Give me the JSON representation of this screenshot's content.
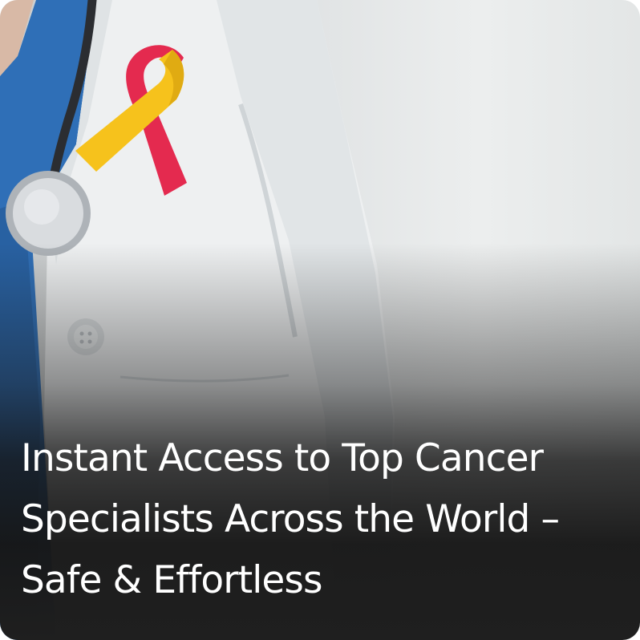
{
  "headline": "Instant Access to Top Cancer Specialists Across the World – Safe & Effortless",
  "image": {
    "subject": "doctor-in-white-coat-with-stethoscope-and-awareness-ribbon",
    "ribbon_colors": [
      "#e42a4f",
      "#f6c21c"
    ],
    "scrubs_color": "#2f6fb7",
    "coat_color": "#eef0f1"
  },
  "overlay": {
    "text_color": "#ffffff",
    "shade_color": "#1f1f1f"
  }
}
